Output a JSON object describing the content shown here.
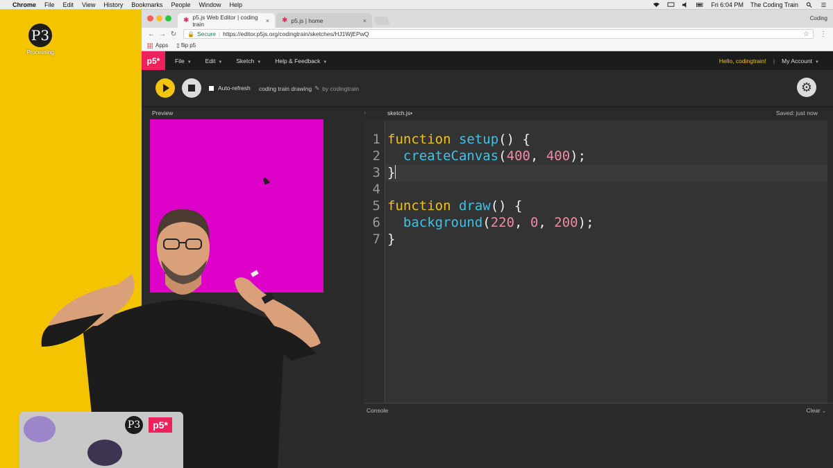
{
  "menubar": {
    "app": "Chrome",
    "items": [
      "File",
      "Edit",
      "View",
      "History",
      "Bookmarks",
      "People",
      "Window",
      "Help"
    ],
    "clock": "Fri 6:04 PM",
    "user": "The Coding Train"
  },
  "desktop": {
    "icon_label": "Processing",
    "icon_glyph": "P3"
  },
  "browser": {
    "tabs": [
      {
        "title": "p5.js Web Editor | coding train",
        "active": true
      },
      {
        "title": "p5.js | home",
        "active": false
      }
    ],
    "profile": "Coding",
    "secure_label": "Secure",
    "url": "https://editor.p5js.org/codingtrain/sketches/HJ1WjEPwQ",
    "bookmarks": [
      "Apps",
      "flip p5"
    ]
  },
  "editor": {
    "logo": "p5*",
    "menu": [
      "File",
      "Edit",
      "Sketch",
      "Help & Feedback"
    ],
    "greeting": "Hello, codingtrain!",
    "account": "My Account",
    "autorefresh_label": "Auto-refresh",
    "sketch_name": "coding train drawing",
    "by_label": "by codingtrain",
    "preview_label": "Preview",
    "file_name": "sketch.js",
    "file_modified_mark": "•",
    "saved_status": "Saved: just now",
    "console_label": "Console",
    "clear_label": "Clear",
    "preview_color": "#dc00c8",
    "code": {
      "line_numbers": [
        "1",
        "2",
        "3",
        "4",
        "5",
        "6",
        "7"
      ],
      "l1_kw": "function",
      "l1_fn": "setup",
      "l1_rest": "() {",
      "l2_fn": "createCanvas",
      "l2_n1": "400",
      "l2_n2": "400",
      "l3": "}",
      "l5_kw": "function",
      "l5_fn": "draw",
      "l5_rest": "() {",
      "l6_fn": "background",
      "l6_n1": "220",
      "l6_n2": "0",
      "l6_n3": "200",
      "l7": "}"
    }
  },
  "laptop": {
    "sticker_p5": "p5*"
  },
  "colors": {
    "p5_pink": "#ed225d",
    "accent_yellow": "#f1c40f",
    "desktop_yellow": "#f5c400"
  }
}
